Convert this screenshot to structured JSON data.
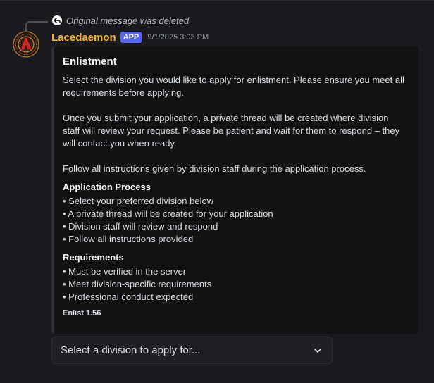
{
  "reply": {
    "text": "Original message was deleted",
    "icon": "reply-arrow-icon"
  },
  "message": {
    "username": "Lacedaemon",
    "badge": "APP",
    "timestamp": "9/1/2025 3:03 PM",
    "avatar_icon": "lambda-shield-logo-icon"
  },
  "embed": {
    "title": "Enlistment",
    "paragraphs": [
      "Select the division you would like to apply for enlistment. Please ensure you meet all requirements before applying.",
      "Once you submit your application, a private thread will be created where division staff will review your request. Please be patient and wait for them to respond – they will contact you when ready.",
      "Follow all instructions given by division staff during the application process."
    ],
    "fields": [
      {
        "name": "Application Process",
        "items": [
          "• Select your preferred division below",
          "• A private thread will be created for your application",
          "• Division staff will review and respond",
          "• Follow all instructions provided"
        ]
      },
      {
        "name": "Requirements",
        "items": [
          "• Must be verified in the server",
          "• Meet division-specific requirements",
          "• Professional conduct expected"
        ]
      }
    ],
    "footer": "Enlist 1.56"
  },
  "select": {
    "placeholder": "Select a division to apply for...",
    "icon": "chevron-down-icon"
  },
  "colors": {
    "background": "#1a1a1e",
    "username": "#f0b232",
    "badge": "#5865f2",
    "embed_bg": "#111214"
  }
}
